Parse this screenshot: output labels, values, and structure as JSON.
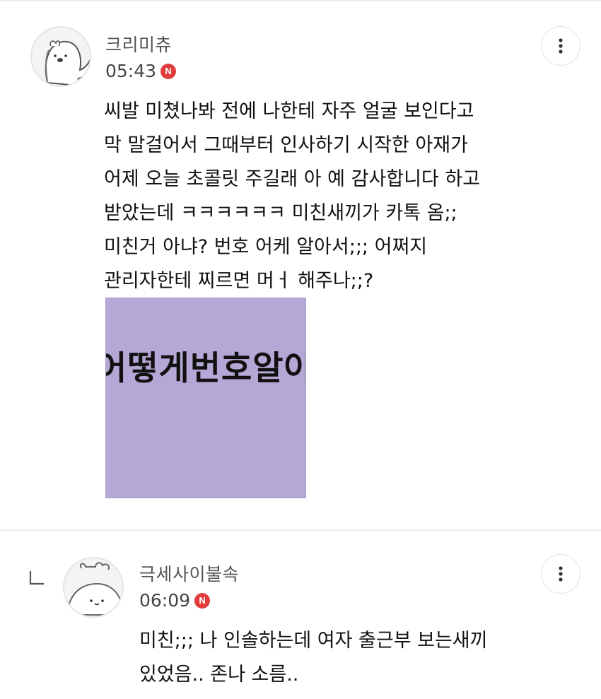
{
  "comments": [
    {
      "author": "크리미츄",
      "time": "05:43",
      "badge": "N",
      "lines": [
        "씨발 미쳤나봐 전에 나한테 자주 얼굴 보인다고",
        "막 말걸어서 그때부터 인사하기 시작한 아재가",
        "어제 오늘 초콜릿 주길래 아 예 감사합니다 하고",
        "받았는데 ㅋㅋㅋㅋㅋㅋ 미친새끼가 카톡 옴;;",
        "미친거 아냐? 번호 어케 알아서;;; 어쩌지",
        "관리자한테 찌르면 머ㅓ 해주나;;?"
      ],
      "image_text": "어떻게번호알아",
      "image_color": "#b5a8d6"
    },
    {
      "author": "극세사이불속",
      "time": "06:09",
      "badge": "N",
      "lines": [
        "미친;;; 나 인솔하는데 여자 출근부 보는새끼",
        "있었음.. 존나 소름.."
      ]
    }
  ],
  "icons": {
    "more": "more-vertical-icon",
    "reply": "reply-arrow-icon",
    "new": "new-badge-icon"
  },
  "colors": {
    "badge": "#e03c3c",
    "divider": "#ececec"
  }
}
